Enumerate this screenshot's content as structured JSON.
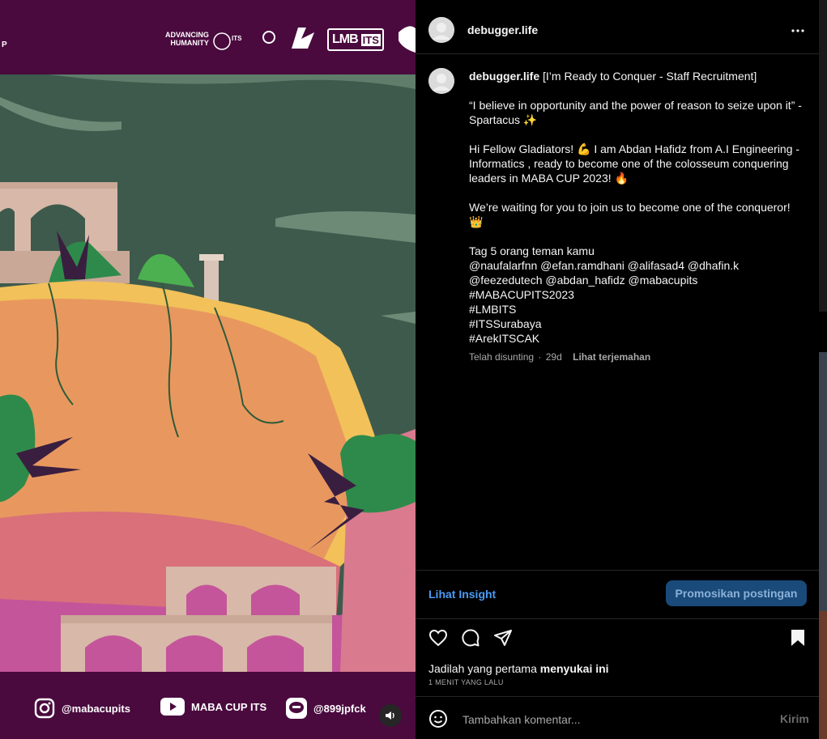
{
  "media": {
    "sponsor_adv": "ADVANCING\nHUMANITY",
    "sponsor_its": "ITS",
    "sponsor_lmb": "LMB",
    "sponsor_lmb_its": "ITS",
    "cut_letter": "P",
    "socials": [
      {
        "icon": "instagram-icon",
        "label": "@mabacupits"
      },
      {
        "icon": "youtube-icon",
        "label": "MABA CUP ITS"
      },
      {
        "icon": "line-icon",
        "label": "@899jpfck"
      }
    ],
    "colors": {
      "purple": "#4a0a3e",
      "sky": "#3e5a4c",
      "cliff": "#e8985e",
      "accent_gold": "#f2c15a"
    }
  },
  "header": {
    "username": "debugger.life"
  },
  "caption": {
    "username": "debugger.life",
    "text": " [I’m Ready to Conquer - Staff Recruitment]\n\n“I believe in opportunity and the power of reason to seize upon it” -Spartacus ✨\n\nHi Fellow Gladiators! 💪 I am Abdan Hafidz from A.I Engineering - Informatics , ready to become one of the colosseum conquering leaders in MABA CUP 2023! 🔥\n\nWe’re waiting for you to join us to become one of the conqueror! 👑\n\nTag 5 orang teman kamu\n@naufalarfnn @efan.ramdhani @alifasad4 @dhafin.k @feezedutech @abdan_hafidz @mabacupits\n#MABACUPITS2023\n#LMBITS\n#ITSSurabaya\n#ArekITSCAK",
    "edited": "Telah disunting",
    "dot": "·",
    "age": "29d",
    "translate": "Lihat terjemahan"
  },
  "insight": {
    "insight_label": "Lihat Insight",
    "promote_label": "Promosikan postingan"
  },
  "likes": {
    "prefix": "Jadilah yang pertama ",
    "bold": "menyukai ini",
    "time": "1 MENIT YANG LALU"
  },
  "comment": {
    "placeholder": "Tambahkan komentar...",
    "post_label": "Kirim"
  }
}
